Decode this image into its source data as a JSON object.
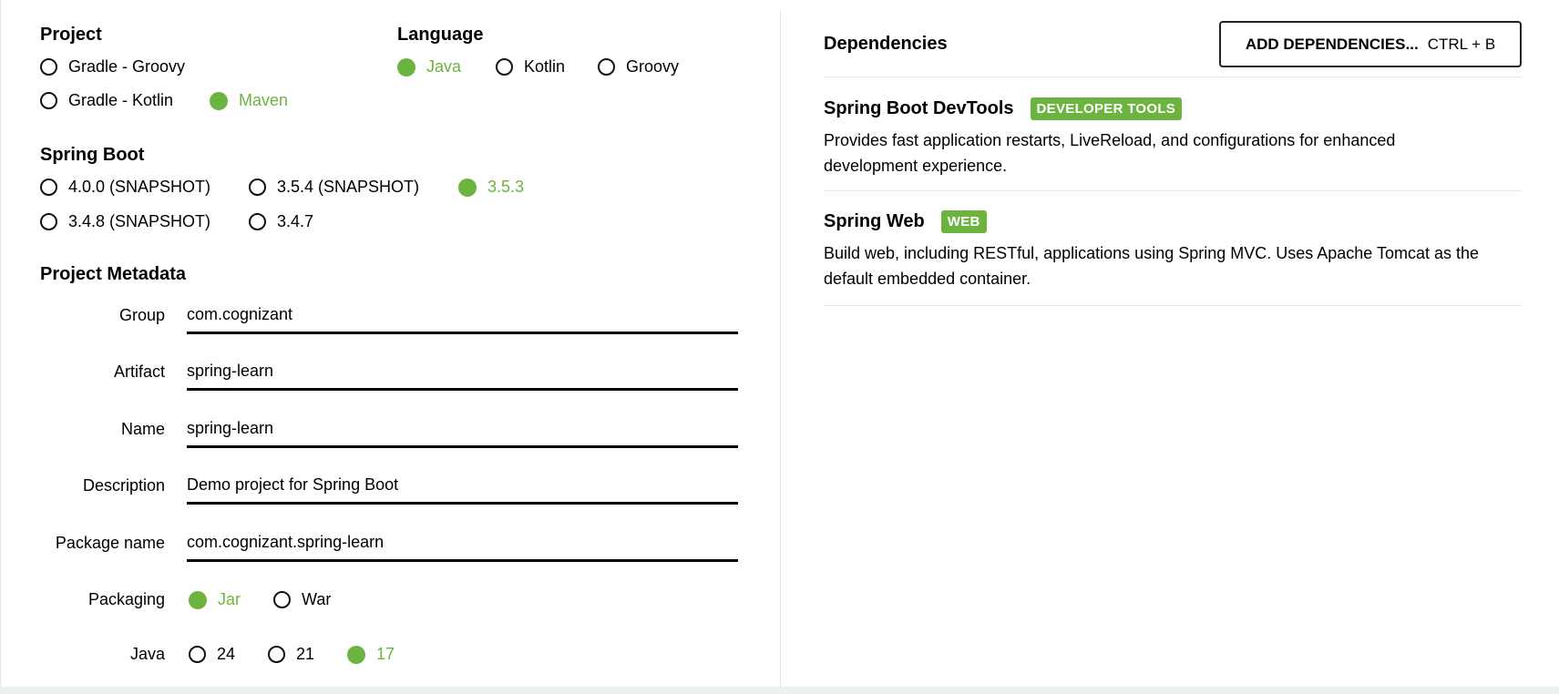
{
  "project": {
    "title": "Project",
    "options": [
      {
        "label": "Gradle - Groovy",
        "checked": false
      },
      {
        "label": "Gradle - Kotlin",
        "checked": false
      },
      {
        "label": "Maven",
        "checked": true
      }
    ]
  },
  "language": {
    "title": "Language",
    "options": [
      {
        "label": "Java",
        "checked": true
      },
      {
        "label": "Kotlin",
        "checked": false
      },
      {
        "label": "Groovy",
        "checked": false
      }
    ]
  },
  "spring_boot": {
    "title": "Spring Boot",
    "options": [
      {
        "label": "4.0.0 (SNAPSHOT)",
        "checked": false
      },
      {
        "label": "3.5.4 (SNAPSHOT)",
        "checked": false
      },
      {
        "label": "3.5.3",
        "checked": true
      },
      {
        "label": "3.4.8 (SNAPSHOT)",
        "checked": false
      },
      {
        "label": "3.4.7",
        "checked": false
      }
    ]
  },
  "metadata": {
    "title": "Project Metadata",
    "group": {
      "label": "Group",
      "value": "com.cognizant"
    },
    "artifact": {
      "label": "Artifact",
      "value": "spring-learn"
    },
    "name": {
      "label": "Name",
      "value": "spring-learn"
    },
    "description": {
      "label": "Description",
      "value": "Demo project for Spring Boot"
    },
    "package_name": {
      "label": "Package name",
      "value": "com.cognizant.spring-learn"
    },
    "packaging": {
      "label": "Packaging",
      "options": [
        {
          "label": "Jar",
          "checked": true
        },
        {
          "label": "War",
          "checked": false
        }
      ]
    },
    "java": {
      "label": "Java",
      "options": [
        {
          "label": "24",
          "checked": false
        },
        {
          "label": "21",
          "checked": false
        },
        {
          "label": "17",
          "checked": true
        }
      ]
    }
  },
  "dependencies": {
    "title": "Dependencies",
    "add_button": {
      "label": "ADD DEPENDENCIES...",
      "shortcut": "CTRL + B"
    },
    "items": [
      {
        "name": "Spring Boot DevTools",
        "badge": "DEVELOPER TOOLS",
        "description": "Provides fast application restarts, LiveReload, and configurations for enhanced development experience."
      },
      {
        "name": "Spring Web",
        "badge": "WEB",
        "description": "Build web, including RESTful, applications using Spring MVC. Uses Apache Tomcat as the default embedded container."
      }
    ]
  },
  "colors": {
    "accent": "#6db33f",
    "text": "#000000",
    "divider": "#e6e6e6"
  }
}
